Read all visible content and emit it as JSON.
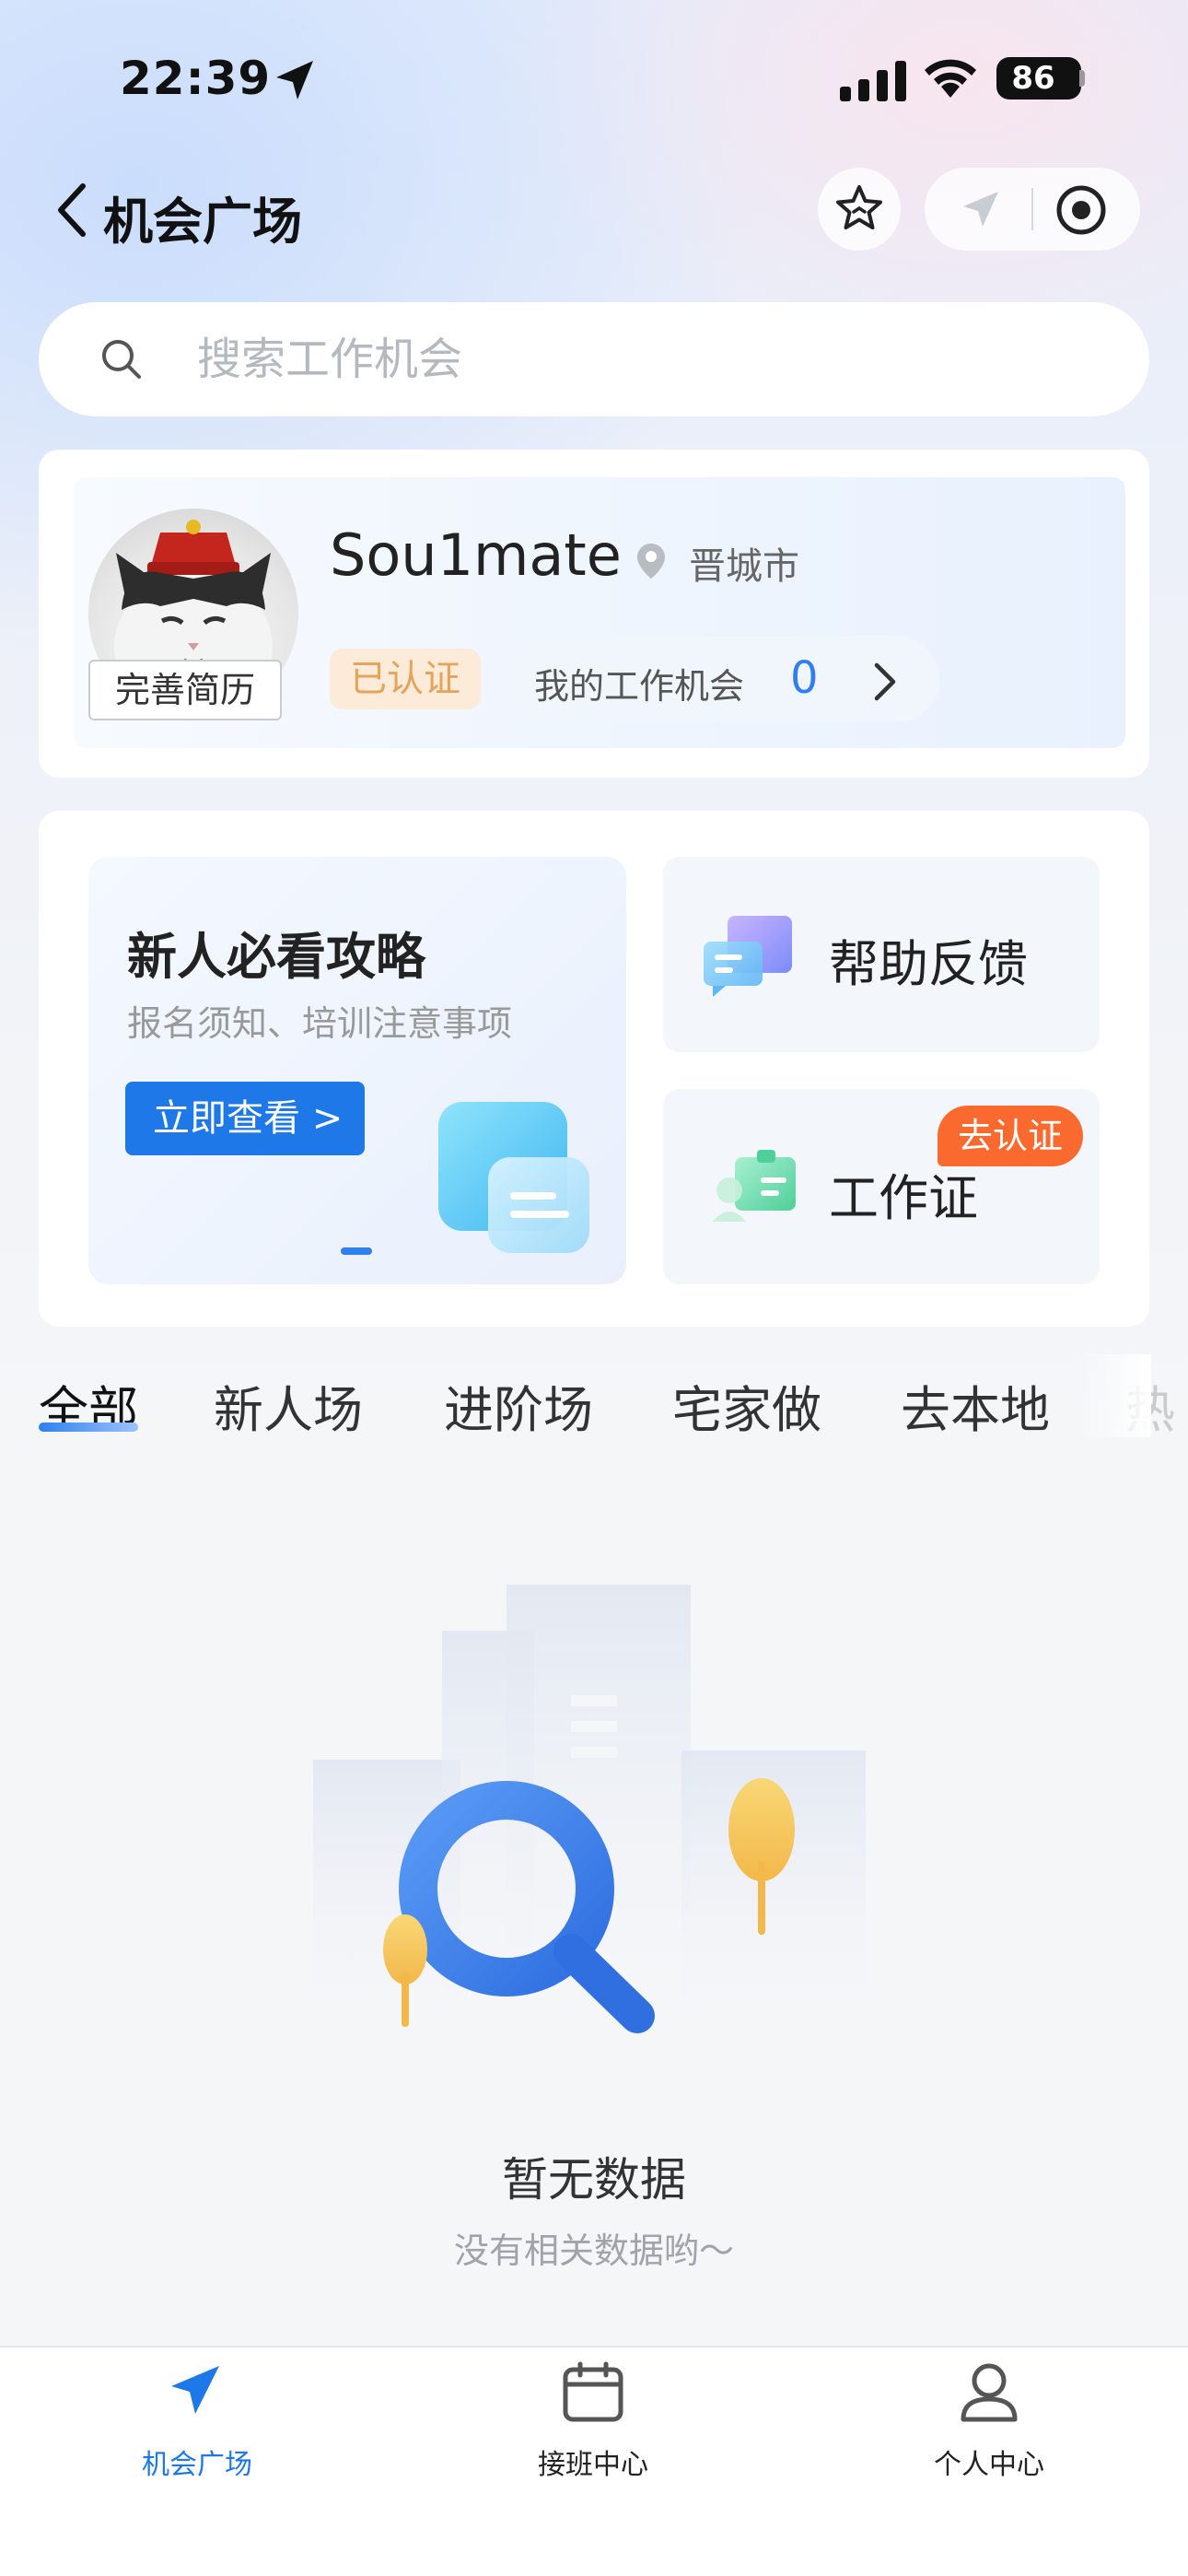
{
  "status_bar": {
    "time": "22:39",
    "battery": "86"
  },
  "nav": {
    "title": "机会广场"
  },
  "search": {
    "placeholder": "搜索工作机会"
  },
  "profile": {
    "username": "Sou1mate",
    "city": "晋城市",
    "resume_badge": "完善简历",
    "verified": "已认证",
    "opportunities_label": "我的工作机会",
    "opportunities_count": "0"
  },
  "features": {
    "guide_title": "新人必看攻略",
    "guide_subtitle": "报名须知、培训注意事项",
    "guide_button": "立即查看 >",
    "help_label": "帮助反馈",
    "cert_label": "工作证",
    "cert_badge": "去认证"
  },
  "tabs": [
    {
      "label": "全部"
    },
    {
      "label": "新人场"
    },
    {
      "label": "进阶场"
    },
    {
      "label": "宅家做"
    },
    {
      "label": "去本地"
    },
    {
      "label": "热"
    }
  ],
  "empty": {
    "title": "暂无数据",
    "subtitle": "没有相关数据哟～"
  },
  "bottom_nav": [
    {
      "label": "机会广场",
      "icon": "send-icon"
    },
    {
      "label": "接班中心",
      "icon": "calendar-icon"
    },
    {
      "label": "个人中心",
      "icon": "person-icon"
    }
  ],
  "colors": {
    "accent": "#2f7ff0",
    "badge": "#fa6a2f",
    "verified": "#e5a45a"
  }
}
